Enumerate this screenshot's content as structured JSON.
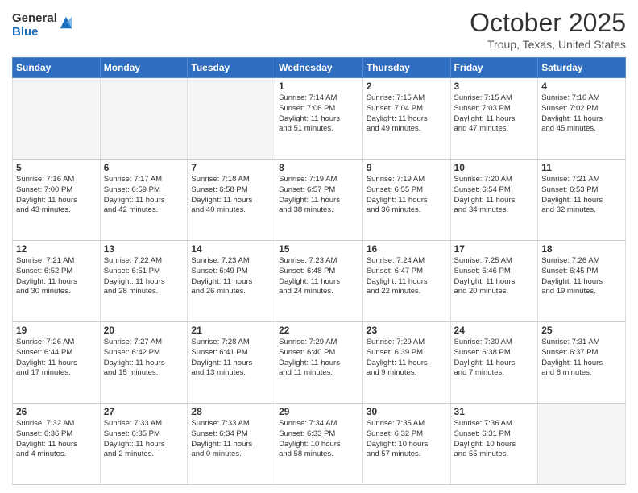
{
  "header": {
    "logo_general": "General",
    "logo_blue": "Blue",
    "month_title": "October 2025",
    "subtitle": "Troup, Texas, United States"
  },
  "weekdays": [
    "Sunday",
    "Monday",
    "Tuesday",
    "Wednesday",
    "Thursday",
    "Friday",
    "Saturday"
  ],
  "weeks": [
    [
      {
        "day": "",
        "info": ""
      },
      {
        "day": "",
        "info": ""
      },
      {
        "day": "",
        "info": ""
      },
      {
        "day": "1",
        "info": "Sunrise: 7:14 AM\nSunset: 7:06 PM\nDaylight: 11 hours\nand 51 minutes."
      },
      {
        "day": "2",
        "info": "Sunrise: 7:15 AM\nSunset: 7:04 PM\nDaylight: 11 hours\nand 49 minutes."
      },
      {
        "day": "3",
        "info": "Sunrise: 7:15 AM\nSunset: 7:03 PM\nDaylight: 11 hours\nand 47 minutes."
      },
      {
        "day": "4",
        "info": "Sunrise: 7:16 AM\nSunset: 7:02 PM\nDaylight: 11 hours\nand 45 minutes."
      }
    ],
    [
      {
        "day": "5",
        "info": "Sunrise: 7:16 AM\nSunset: 7:00 PM\nDaylight: 11 hours\nand 43 minutes."
      },
      {
        "day": "6",
        "info": "Sunrise: 7:17 AM\nSunset: 6:59 PM\nDaylight: 11 hours\nand 42 minutes."
      },
      {
        "day": "7",
        "info": "Sunrise: 7:18 AM\nSunset: 6:58 PM\nDaylight: 11 hours\nand 40 minutes."
      },
      {
        "day": "8",
        "info": "Sunrise: 7:19 AM\nSunset: 6:57 PM\nDaylight: 11 hours\nand 38 minutes."
      },
      {
        "day": "9",
        "info": "Sunrise: 7:19 AM\nSunset: 6:55 PM\nDaylight: 11 hours\nand 36 minutes."
      },
      {
        "day": "10",
        "info": "Sunrise: 7:20 AM\nSunset: 6:54 PM\nDaylight: 11 hours\nand 34 minutes."
      },
      {
        "day": "11",
        "info": "Sunrise: 7:21 AM\nSunset: 6:53 PM\nDaylight: 11 hours\nand 32 minutes."
      }
    ],
    [
      {
        "day": "12",
        "info": "Sunrise: 7:21 AM\nSunset: 6:52 PM\nDaylight: 11 hours\nand 30 minutes."
      },
      {
        "day": "13",
        "info": "Sunrise: 7:22 AM\nSunset: 6:51 PM\nDaylight: 11 hours\nand 28 minutes."
      },
      {
        "day": "14",
        "info": "Sunrise: 7:23 AM\nSunset: 6:49 PM\nDaylight: 11 hours\nand 26 minutes."
      },
      {
        "day": "15",
        "info": "Sunrise: 7:23 AM\nSunset: 6:48 PM\nDaylight: 11 hours\nand 24 minutes."
      },
      {
        "day": "16",
        "info": "Sunrise: 7:24 AM\nSunset: 6:47 PM\nDaylight: 11 hours\nand 22 minutes."
      },
      {
        "day": "17",
        "info": "Sunrise: 7:25 AM\nSunset: 6:46 PM\nDaylight: 11 hours\nand 20 minutes."
      },
      {
        "day": "18",
        "info": "Sunrise: 7:26 AM\nSunset: 6:45 PM\nDaylight: 11 hours\nand 19 minutes."
      }
    ],
    [
      {
        "day": "19",
        "info": "Sunrise: 7:26 AM\nSunset: 6:44 PM\nDaylight: 11 hours\nand 17 minutes."
      },
      {
        "day": "20",
        "info": "Sunrise: 7:27 AM\nSunset: 6:42 PM\nDaylight: 11 hours\nand 15 minutes."
      },
      {
        "day": "21",
        "info": "Sunrise: 7:28 AM\nSunset: 6:41 PM\nDaylight: 11 hours\nand 13 minutes."
      },
      {
        "day": "22",
        "info": "Sunrise: 7:29 AM\nSunset: 6:40 PM\nDaylight: 11 hours\nand 11 minutes."
      },
      {
        "day": "23",
        "info": "Sunrise: 7:29 AM\nSunset: 6:39 PM\nDaylight: 11 hours\nand 9 minutes."
      },
      {
        "day": "24",
        "info": "Sunrise: 7:30 AM\nSunset: 6:38 PM\nDaylight: 11 hours\nand 7 minutes."
      },
      {
        "day": "25",
        "info": "Sunrise: 7:31 AM\nSunset: 6:37 PM\nDaylight: 11 hours\nand 6 minutes."
      }
    ],
    [
      {
        "day": "26",
        "info": "Sunrise: 7:32 AM\nSunset: 6:36 PM\nDaylight: 11 hours\nand 4 minutes."
      },
      {
        "day": "27",
        "info": "Sunrise: 7:33 AM\nSunset: 6:35 PM\nDaylight: 11 hours\nand 2 minutes."
      },
      {
        "day": "28",
        "info": "Sunrise: 7:33 AM\nSunset: 6:34 PM\nDaylight: 11 hours\nand 0 minutes."
      },
      {
        "day": "29",
        "info": "Sunrise: 7:34 AM\nSunset: 6:33 PM\nDaylight: 10 hours\nand 58 minutes."
      },
      {
        "day": "30",
        "info": "Sunrise: 7:35 AM\nSunset: 6:32 PM\nDaylight: 10 hours\nand 57 minutes."
      },
      {
        "day": "31",
        "info": "Sunrise: 7:36 AM\nSunset: 6:31 PM\nDaylight: 10 hours\nand 55 minutes."
      },
      {
        "day": "",
        "info": ""
      }
    ]
  ]
}
